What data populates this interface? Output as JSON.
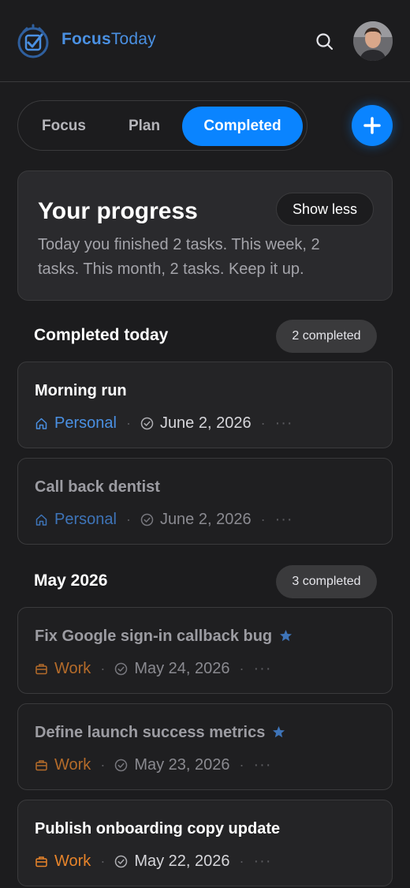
{
  "brand": {
    "name_bold": "Focus",
    "name_light": "Today"
  },
  "header": {
    "search_icon": "search-icon",
    "avatar": "user-avatar"
  },
  "tabs": [
    {
      "label": "Focus",
      "active": false
    },
    {
      "label": "Plan",
      "active": false
    },
    {
      "label": "Completed",
      "active": true
    }
  ],
  "add_button": {
    "icon": "plus-icon"
  },
  "progress": {
    "title": "Your progress",
    "toggle_label": "Show less",
    "summary": "Today you finished 2 tasks. This week, 2 tasks. This month, 2 tasks. Keep it up."
  },
  "sections": [
    {
      "title": "Completed today",
      "count_label": "2 completed",
      "tasks": [
        {
          "title": "Morning run",
          "category": "Personal",
          "date": "June 2, 2026",
          "starred": false
        },
        {
          "title": "Call back dentist",
          "category": "Personal",
          "date": "June 2, 2026",
          "starred": false
        }
      ]
    },
    {
      "title": "May 2026",
      "count_label": "3 completed",
      "tasks": [
        {
          "title": "Fix Google sign-in callback bug",
          "category": "Work",
          "date": "May 24, 2026",
          "starred": true
        },
        {
          "title": "Define launch success metrics",
          "category": "Work",
          "date": "May 23, 2026",
          "starred": true
        },
        {
          "title": "Publish onboarding copy update",
          "category": "Work",
          "date": "May 22, 2026",
          "starred": false
        }
      ]
    }
  ],
  "meta": {
    "separator": "·",
    "more": "···"
  },
  "colors": {
    "accent": "#0a84ff",
    "brand": "#4a90e2",
    "personal": "#4a90e2",
    "work": "#e8842a",
    "background": "#1c1c1e",
    "card": "#2a2a2d"
  }
}
